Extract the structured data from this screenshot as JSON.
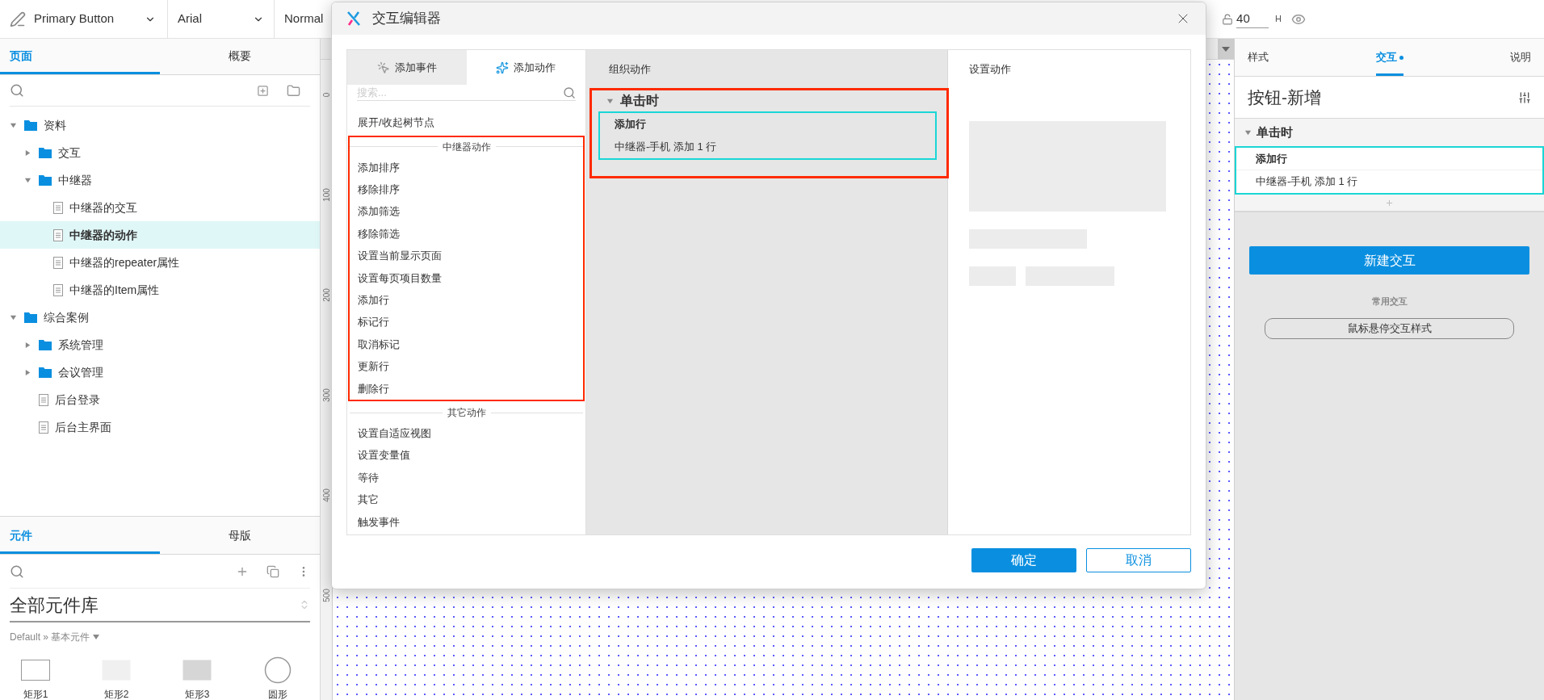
{
  "toolbar": {
    "style_name": "Primary Button",
    "font": "Arial",
    "weight": "Normal",
    "height_value": "40",
    "height_label": "H"
  },
  "pages_panel": {
    "tabs": [
      {
        "label": "页面",
        "selected": true
      },
      {
        "label": "概要",
        "selected": false
      }
    ],
    "tree": [
      {
        "label": "资料",
        "kind": "folder",
        "expanded": true,
        "selected": false,
        "children": [
          {
            "label": "交互",
            "kind": "folder",
            "expanded": false,
            "selected": false
          },
          {
            "label": "中继器",
            "kind": "folder",
            "expanded": true,
            "selected": false,
            "children": [
              {
                "label": "中继器的交互",
                "kind": "page",
                "selected": false
              },
              {
                "label": "中继器的动作",
                "kind": "page",
                "selected": true
              },
              {
                "label": "中继器的repeater属性",
                "kind": "page",
                "selected": false
              },
              {
                "label": "中继器的Item属性",
                "kind": "page",
                "selected": false
              }
            ]
          }
        ]
      },
      {
        "label": "综合案例",
        "kind": "folder",
        "expanded": true,
        "selected": false,
        "children": [
          {
            "label": "系统管理",
            "kind": "folder",
            "expanded": false,
            "selected": false
          },
          {
            "label": "会议管理",
            "kind": "folder",
            "expanded": false,
            "selected": false
          },
          {
            "label": "后台登录",
            "kind": "page",
            "selected": false
          },
          {
            "label": "后台主界面",
            "kind": "page",
            "selected": false
          }
        ]
      }
    ]
  },
  "library_panel": {
    "tabs": [
      {
        "label": "元件",
        "selected": true
      },
      {
        "label": "母版",
        "selected": false
      }
    ],
    "library": "全部元件库",
    "breadcrumb": "Default » 基本元件",
    "widgets": [
      {
        "label": "矩形1",
        "kind": "outline"
      },
      {
        "label": "矩形2",
        "kind": "light"
      },
      {
        "label": "矩形3",
        "kind": "gray"
      },
      {
        "label": "圆形",
        "kind": "circle"
      }
    ]
  },
  "canvas": {
    "ruler_marks": [
      "0",
      "100",
      "200",
      "300",
      "400",
      "500"
    ]
  },
  "dialog": {
    "title": "交互编辑器",
    "tabs": [
      {
        "label": "添加事件",
        "selected": false,
        "kind": "event"
      },
      {
        "label": "添加动作",
        "selected": true,
        "kind": "action"
      }
    ],
    "search": {
      "placeholder": "搜索..."
    },
    "action_groups": [
      {
        "items": [
          "展开/收起树节点"
        ],
        "highlighted": false
      },
      {
        "heading": "中继器动作",
        "highlighted": true,
        "items": [
          "添加排序",
          "移除排序",
          "添加筛选",
          "移除筛选",
          "设置当前显示页面",
          "设置每页项目数量",
          "添加行",
          "标记行",
          "取消标记",
          "更新行",
          "删除行"
        ]
      },
      {
        "heading": "其它动作",
        "highlighted": false,
        "items": [
          "设置自适应视图",
          "设置变量值",
          "等待",
          "其它",
          "触发事件"
        ]
      }
    ],
    "organize": {
      "heading": "组织动作",
      "event": "单击时",
      "expanded": true,
      "highlighted": true,
      "actions": [
        {
          "title": "添加行",
          "detail": "中继器-手机 添加 1 行",
          "highlighted": true
        }
      ]
    },
    "settings": {
      "heading": "设置动作"
    },
    "buttons": [
      {
        "label": "确定",
        "kind": "primary"
      },
      {
        "label": "取消",
        "kind": "secondary"
      }
    ]
  },
  "inspector": {
    "tabs": [
      {
        "label": "样式",
        "selected": false,
        "dot": false
      },
      {
        "label": "交互",
        "selected": true,
        "dot": true
      },
      {
        "label": "说明",
        "selected": false,
        "dot": false
      }
    ],
    "name": "按钮-新增",
    "event": "单击时",
    "expanded": true,
    "actions": [
      {
        "title": "添加行",
        "detail": "中继器-手机 添加 1 行",
        "highlighted": true
      }
    ],
    "new_button": "新建交互",
    "common_label": "常用交互",
    "common_button": "鼠标悬停交互样式"
  }
}
